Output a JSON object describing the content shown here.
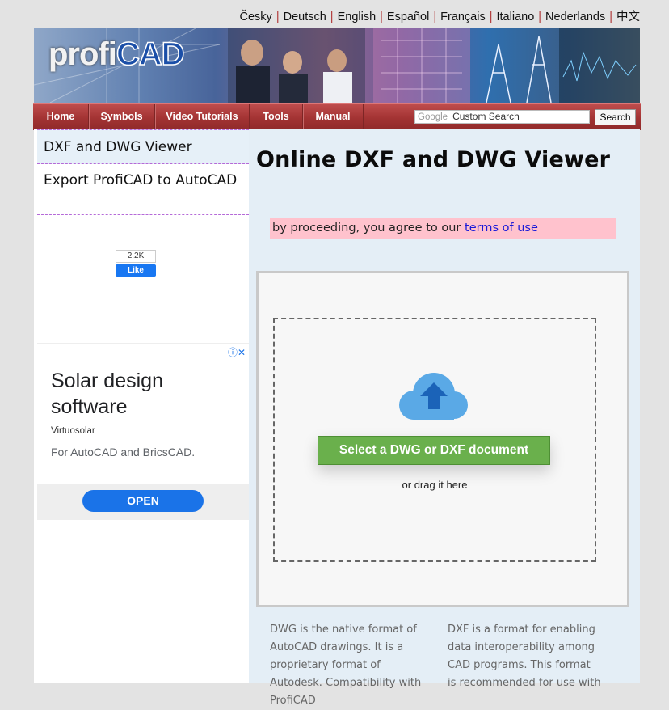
{
  "languages": [
    "Česky",
    "Deutsch",
    "English",
    "Español",
    "Français",
    "Italiano",
    "Nederlands",
    "中文"
  ],
  "language_separator": "|",
  "logo": {
    "part1": "profi",
    "part2": "CAD"
  },
  "nav": {
    "items": [
      "Home",
      "Symbols",
      "Video Tutorials",
      "Tools",
      "Manual"
    ],
    "search_brand": "Google",
    "search_placeholder": "Custom Search",
    "search_button": "Search"
  },
  "sidebar": {
    "items": [
      "DXF and DWG Viewer",
      "Export ProfiCAD to AutoCAD"
    ],
    "like_count": "2.2K",
    "like_label": "Like"
  },
  "ad": {
    "title": "Solar design software",
    "sponsor": "Virtuosolar",
    "description": "For AutoCAD and BricsCAD.",
    "button": "OPEN",
    "info_icon": "ⓘ✕"
  },
  "main": {
    "title": "Online DXF and DWG Viewer",
    "notice_text": "by proceeding, you agree to our ",
    "terms_link": "terms of use",
    "select_button": "Select a DWG or DXF document",
    "drag_text": "or drag it here",
    "dwg_desc": "DWG is the native format of AutoCAD drawings. It is a proprietary format of Autodesk. Compatibility with ProfiCAD",
    "dxf_desc": "DXF is a format for enabling data interoperability among CAD programs. This format is recommended for use with"
  },
  "colors": {
    "nav_red": "#a33333",
    "notice_pink": "#ffc2cd",
    "select_green": "#6ab04c",
    "cloud_blue": "#5aa9e6",
    "ad_button_blue": "#1a73e8",
    "link_blue": "#1a1ad8"
  }
}
